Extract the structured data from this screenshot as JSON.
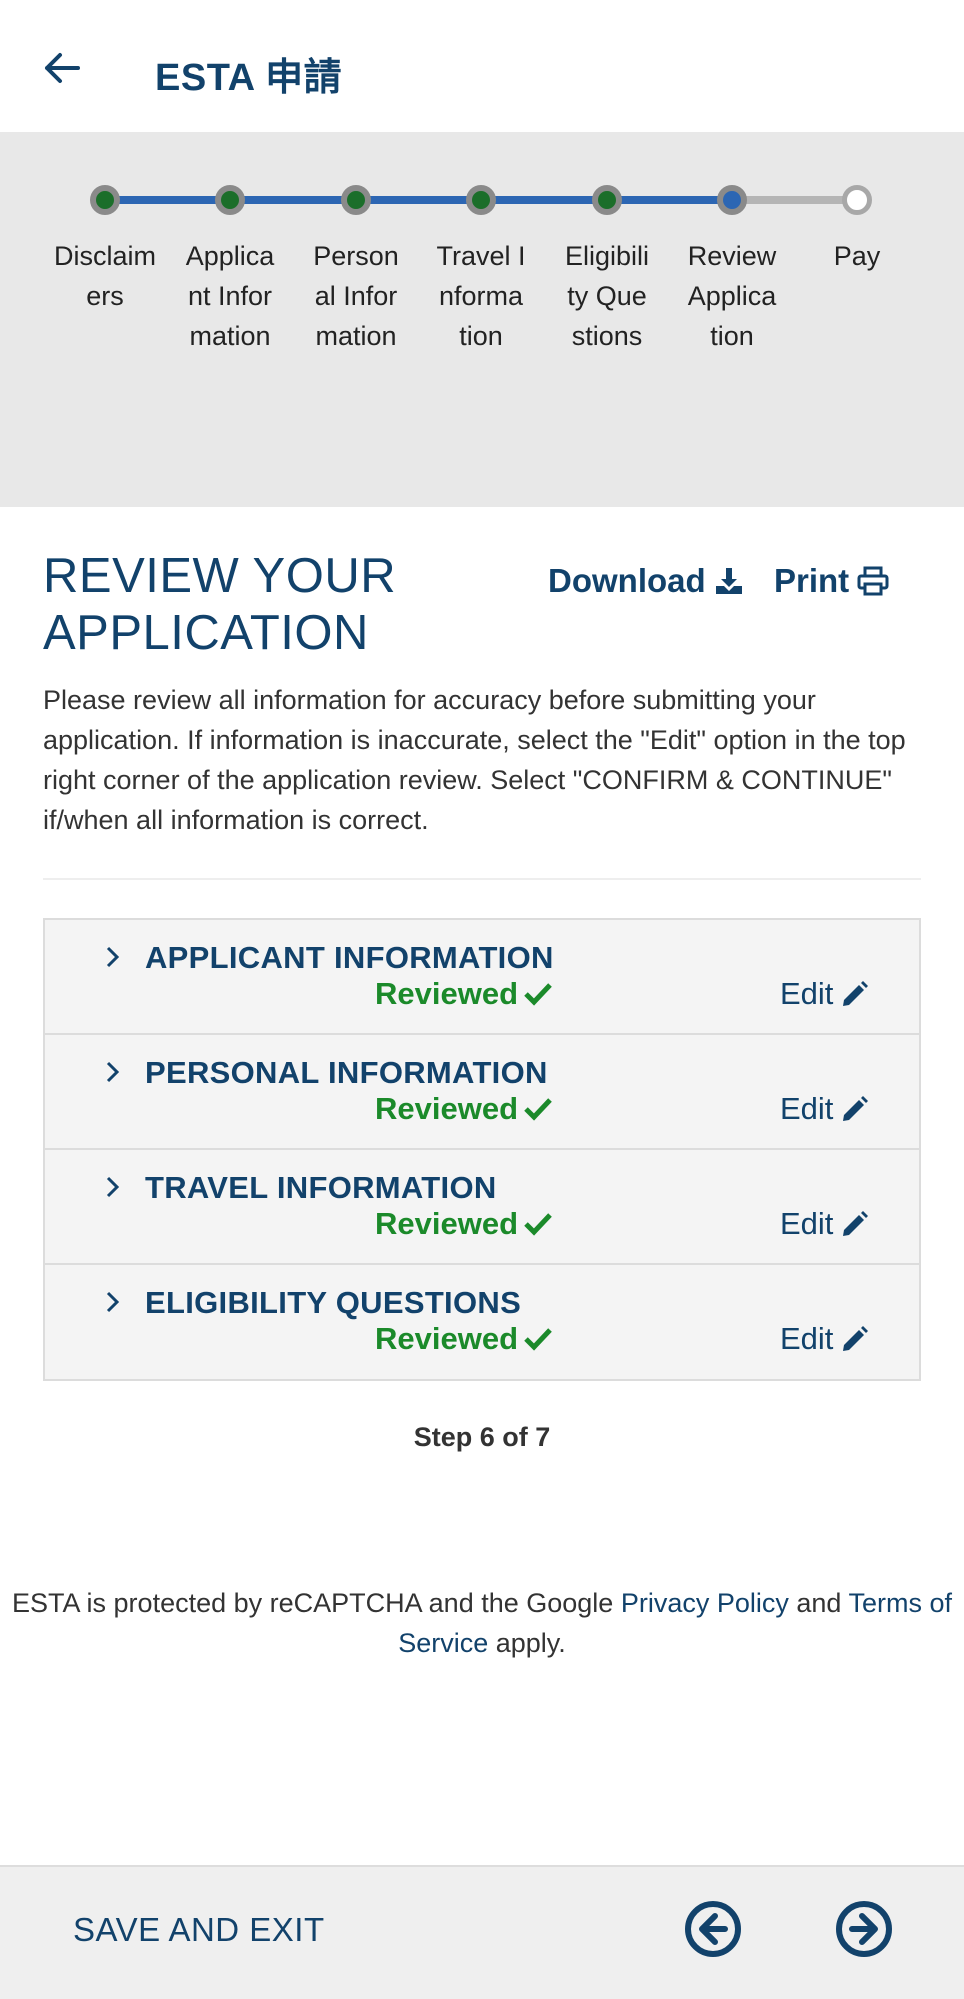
{
  "header": {
    "title": "ESTA 申請"
  },
  "progress": {
    "steps": [
      {
        "label": "Disclaimers",
        "state": "done"
      },
      {
        "label": "Applicant Information",
        "state": "done"
      },
      {
        "label": "Personal Information",
        "state": "done"
      },
      {
        "label": "Travel Information",
        "state": "done"
      },
      {
        "label": "Eligibility Questions",
        "state": "done"
      },
      {
        "label": "Review Application",
        "state": "current"
      },
      {
        "label": "Pay",
        "state": "todo"
      }
    ]
  },
  "review": {
    "title": "REVIEW YOUR APPLICATION",
    "download_label": "Download",
    "print_label": "Print",
    "intro": "Please review all information for accuracy before submitting your application. If information is inaccurate, select the \"Edit\" option in the top right corner of the application review. Select \"CONFIRM & CONTINUE\" if/when all information is correct.",
    "sections": [
      {
        "title": "APPLICANT INFORMATION",
        "status": "Reviewed",
        "edit": "Edit"
      },
      {
        "title": "PERSONAL INFORMATION",
        "status": "Reviewed",
        "edit": "Edit"
      },
      {
        "title": "TRAVEL INFORMATION",
        "status": "Reviewed",
        "edit": "Edit"
      },
      {
        "title": "ELIGIBILITY QUESTIONS",
        "status": "Reviewed",
        "edit": "Edit"
      }
    ],
    "step_counter": "Step 6 of 7"
  },
  "footer": {
    "prefix": "ESTA is protected by reCAPTCHA and the Google ",
    "privacy_link": "Privacy Policy",
    "middle": " and ",
    "terms_link": "Terms of Service",
    "suffix": " apply."
  },
  "bottom_bar": {
    "save_exit_label": "SAVE AND EXIT"
  },
  "colors": {
    "brand_navy": "#12426b",
    "progress_blue": "#2c66b3",
    "done_green": "#1b6e2a",
    "reviewed_green": "#1b8a2a"
  },
  "icons": {
    "back": "arrow-left-icon",
    "download": "download-icon",
    "print": "printer-icon",
    "chevron": "chevron-right-icon",
    "check": "check-icon",
    "edit": "pencil-icon",
    "prev": "circle-arrow-left-icon",
    "next": "circle-arrow-right-icon"
  }
}
